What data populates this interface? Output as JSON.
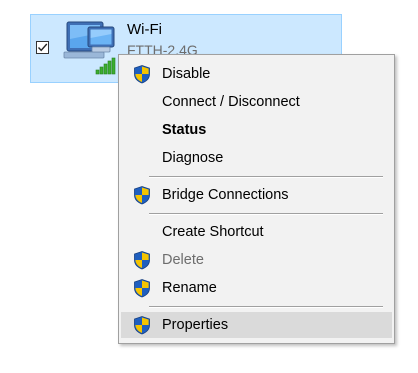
{
  "adapter": {
    "name": "Wi-Fi",
    "network": "FTTH-2.4G",
    "icon": "wireless-network-adapter-icon",
    "checked": true
  },
  "context_menu": {
    "items": [
      {
        "label": "Disable",
        "shield": true
      },
      {
        "label": "Connect / Disconnect",
        "shield": false
      },
      {
        "label": "Status",
        "shield": false,
        "bold": true
      },
      {
        "label": "Diagnose",
        "shield": false
      },
      {
        "label": "Bridge Connections",
        "shield": true
      },
      {
        "label": "Create Shortcut",
        "shield": false
      },
      {
        "label": "Delete",
        "shield": true,
        "disabled": true
      },
      {
        "label": "Rename",
        "shield": true
      },
      {
        "label": "Properties",
        "shield": true,
        "highlighted": true
      }
    ]
  },
  "colors": {
    "selection_bg": "#cce8ff",
    "selection_border": "#99d1ff",
    "menu_bg": "#f2f2f2",
    "menu_highlight": "#dadada",
    "shield_blue": "#1f5fbf",
    "shield_yellow": "#f5c400",
    "signal_green": "#3cae2f"
  }
}
